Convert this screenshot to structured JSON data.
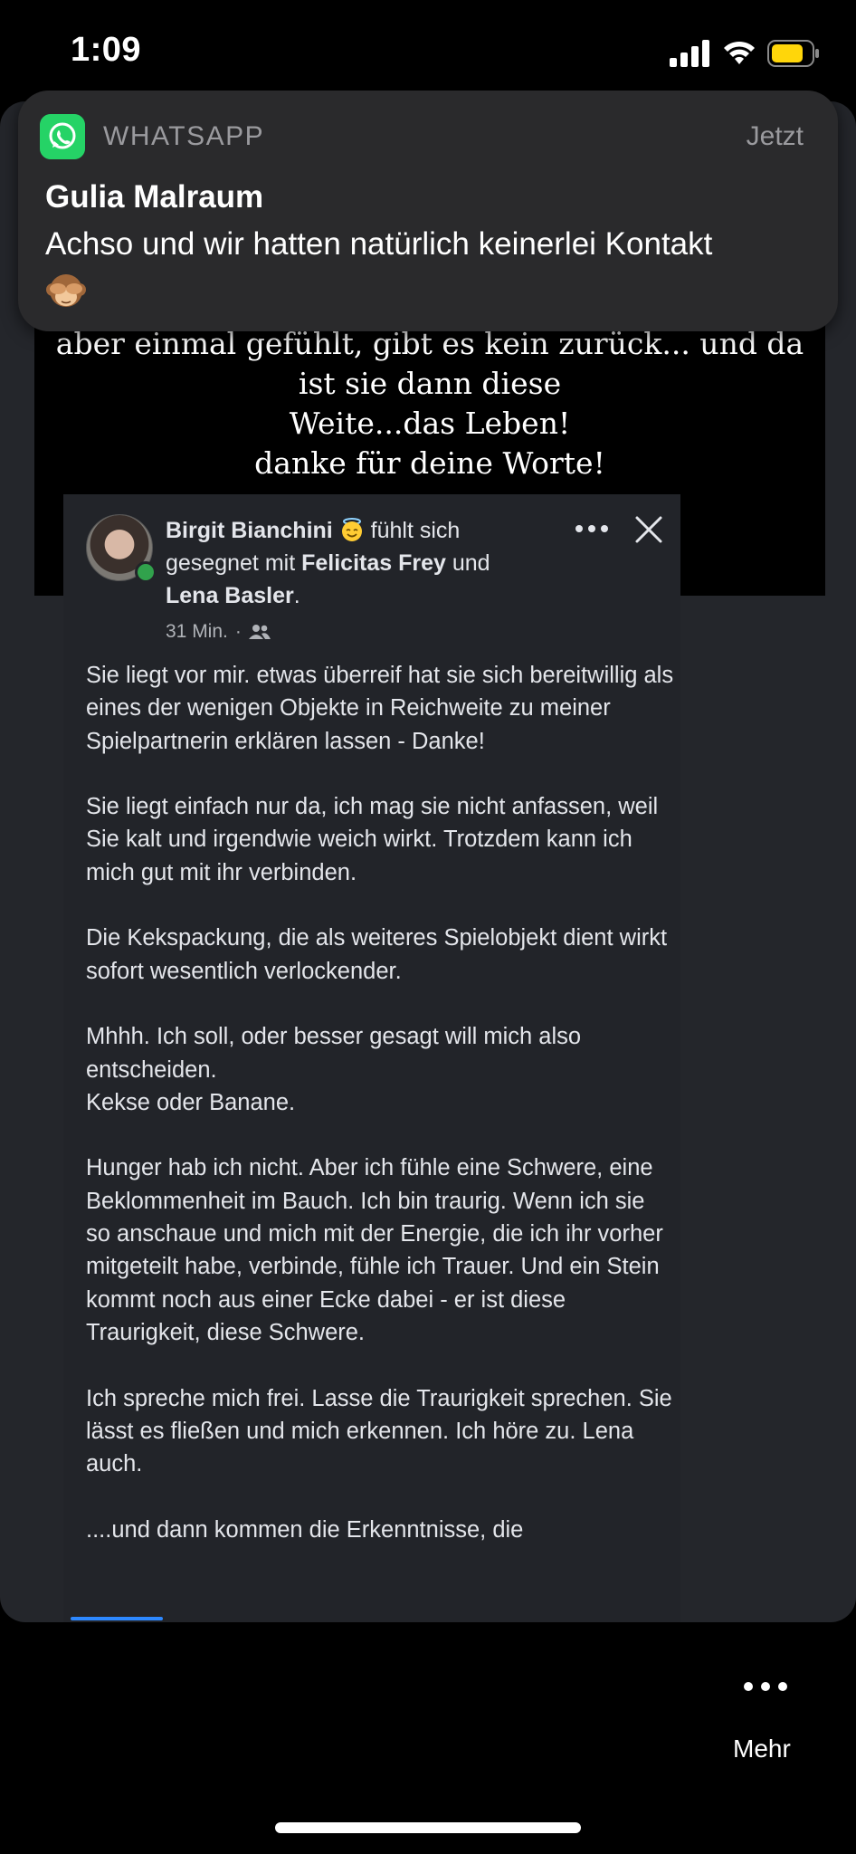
{
  "status_bar": {
    "time": "1:09",
    "icons": [
      "cellular-signal-icon",
      "wifi-icon",
      "battery-icon"
    ],
    "battery_color": "#ffd60a"
  },
  "notification": {
    "app": "WHATSAPP",
    "time": "Jetzt",
    "sender": "Gulia Malraum",
    "message": "Achso und wir hatten natürlich keinerlei Kontakt",
    "emoji_icon": "see-no-evil-monkey-icon",
    "app_color": "#25d366"
  },
  "story": {
    "quote_lines": [
      "aber einmal gefühlt, gibt es kein zurück... und da",
      "ist sie dann diese",
      "Weite...das Leben!",
      "danke für deine Worte!"
    ]
  },
  "post": {
    "author": "Birgit Bianchini",
    "feeling_text": "fühlt sich",
    "feeling_text_2": "gesegnet mit",
    "tagged_1": "Felicitas Frey",
    "conjunction": "und",
    "tagged_2": "Lena Basler",
    "time": "31 Min.",
    "audience_icon": "friends-icon",
    "body": [
      "Sie liegt vor mir. etwas überreif hat sie sich bereitwillig als eines der wenigen Objekte in Reichweite zu meiner Spielpartnerin erklären lassen - Danke!",
      "Sie liegt einfach nur da, ich mag sie nicht anfassen, weil Sie kalt und irgendwie weich wirkt. Trotzdem kann ich mich gut mit ihr verbinden.",
      "Die Kekspackung, die als weiteres Spielobjekt dient wirkt sofort wesentlich verlockender.",
      "Mhhh. Ich soll, oder besser gesagt will mich also entscheiden.",
      "Kekse oder Banane.",
      "Hunger hab ich nicht. Aber ich fühle eine Schwere, eine Beklommenheit im Bauch. Ich bin traurig. Wenn ich sie so anschaue und mich mit der Energie, die ich ihr vorher mitgeteilt habe, verbinde, fühle ich Trauer. Und ein Stein kommt noch aus einer Ecke dabei - er ist diese Traurigkeit, diese Schwere.",
      "Ich spreche mich frei. Lasse die Traurigkeit sprechen. Sie lässt es fließen und mich erkennen. Ich höre zu. Lena auch.",
      "....und dann kommen die Erkenntnisse, die"
    ],
    "accent_color": "#2d88ff"
  },
  "footer": {
    "more_label": "Mehr"
  }
}
